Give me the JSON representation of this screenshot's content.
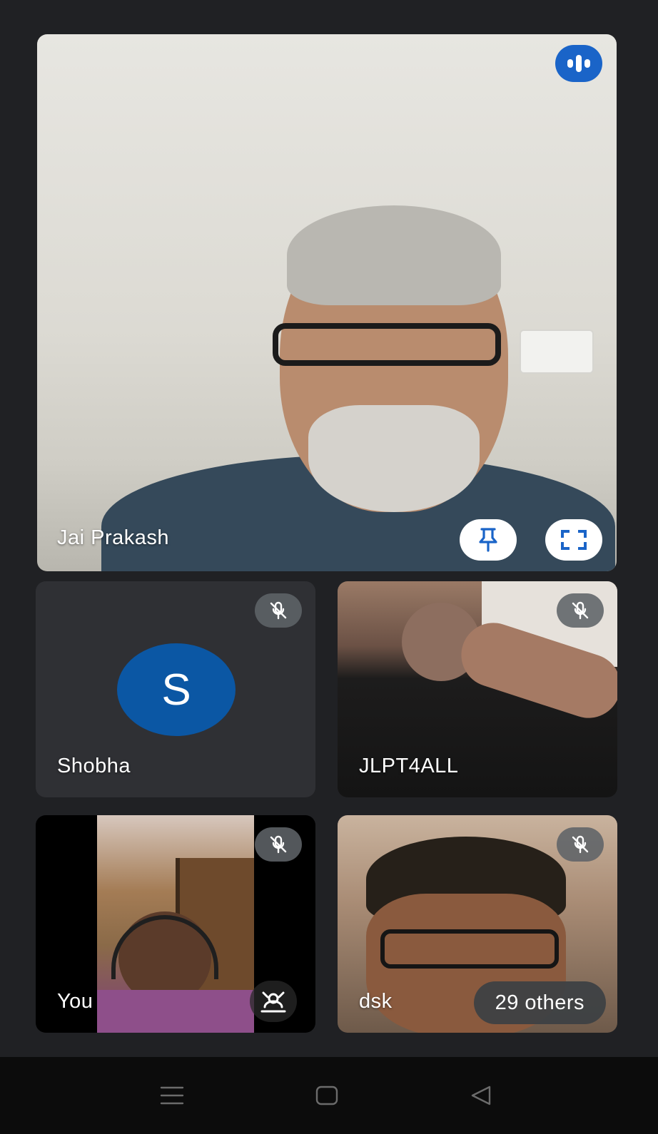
{
  "participants": {
    "main": {
      "name": "Jai Prakash"
    },
    "grid": [
      {
        "name": "Shobha",
        "avatar_initial": "S",
        "muted": true
      },
      {
        "name": "JLPT4ALL",
        "muted": true
      },
      {
        "name": "You",
        "muted": true
      },
      {
        "name": "dsk",
        "muted": true
      }
    ]
  },
  "others_chip": {
    "label": "29 others"
  },
  "icons": {
    "speaking_indicator": "speaking-indicator-icon",
    "pin": "pin-icon",
    "fullscreen": "fullscreen-icon",
    "mic_off": "mic-off-icon",
    "camera_switch": "camera-switch-icon",
    "nav_menu": "menu-icon",
    "nav_home": "home-icon",
    "nav_back": "back-icon"
  },
  "colors": {
    "background": "#202124",
    "speaking_badge": "#1a64c8",
    "avatar": "#0b57a4",
    "pin_icon": "#1a64c8"
  }
}
